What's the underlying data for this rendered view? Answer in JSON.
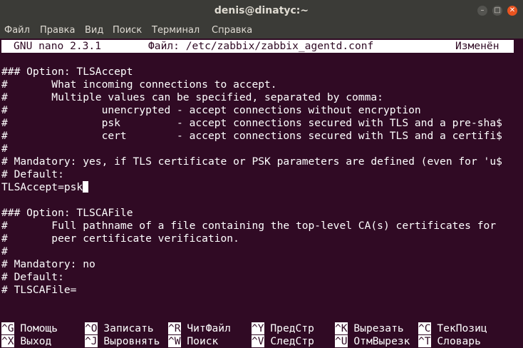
{
  "window": {
    "title": "denis@dinatyc:~"
  },
  "menu": [
    "Файл",
    "Правка",
    "Вид",
    "Поиск",
    "Терминал",
    "Справка"
  ],
  "nano_header": {
    "version": "GNU nano 2.3.1",
    "file": "Файл: /etc/zabbix/zabbix_agentd.conf",
    "status": "Изменён"
  },
  "editor_lines": [
    "### Option: TLSAccept",
    "#       What incoming connections to accept.",
    "#       Multiple values can be specified, separated by comma:",
    "#               unencrypted - accept connections without encryption",
    "#               psk         - accept connections secured with TLS and a pre-sha$",
    "#               cert        - accept connections secured with TLS and a certifi$",
    "#",
    "# Mandatory: yes, if TLS certificate or PSK parameters are defined (even for 'u$",
    "# Default:",
    "TLSAccept=psk",
    "",
    "### Option: TLSCAFile",
    "#       Full pathname of a file containing the top-level CA(s) certificates for",
    "#       peer certificate verification.",
    "#",
    "# Mandatory: no",
    "# Default:",
    "# TLSCAFile="
  ],
  "shortcuts_row1": [
    {
      "key": "^G",
      "label": "Помощь"
    },
    {
      "key": "^O",
      "label": "Записать"
    },
    {
      "key": "^R",
      "label": "ЧитФайл"
    },
    {
      "key": "^Y",
      "label": "ПредСтр"
    },
    {
      "key": "^K",
      "label": "Вырезать"
    },
    {
      "key": "^C",
      "label": "ТекПозиц"
    }
  ],
  "shortcuts_row2": [
    {
      "key": "^X",
      "label": "Выход"
    },
    {
      "key": "^J",
      "label": "Выровнять"
    },
    {
      "key": "^W",
      "label": "Поиск"
    },
    {
      "key": "^V",
      "label": "СледСтр"
    },
    {
      "key": "^U",
      "label": "ОтмВырезк"
    },
    {
      "key": "^T",
      "label": "Словарь"
    }
  ]
}
